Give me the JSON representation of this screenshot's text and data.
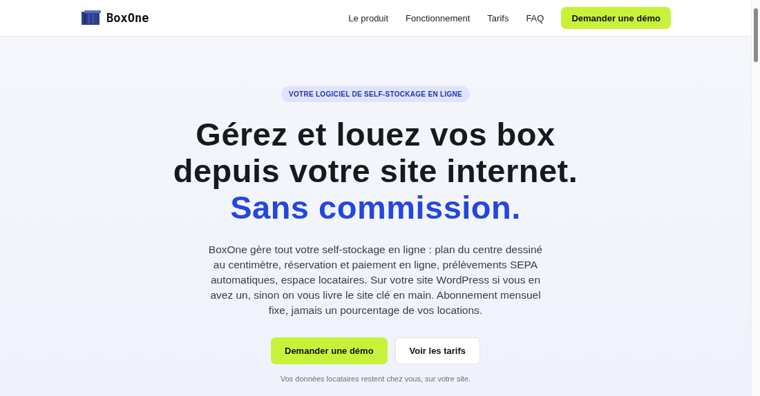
{
  "header": {
    "brand": "BoxOne",
    "nav": [
      "Le produit",
      "Fonctionnement",
      "Tarifs",
      "FAQ"
    ],
    "cta": "Demander une démo"
  },
  "hero": {
    "badge": "VOTRE LOGICIEL DE SELF-STOCKAGE EN LIGNE",
    "title_lines": [
      "Gérez et louez vos box",
      "depuis votre site internet."
    ],
    "title_accent": "Sans commission.",
    "description": "BoxOne gère tout votre self-stockage en ligne : plan du centre dessiné au centimètre, réservation et paiement en ligne, prélèvements SEPA automatiques, espace locataires. Sur votre site WordPress si vous en avez un, sinon on vous livre le site clé en main. Abonnement mensuel fixe, jamais un pourcentage de vos locations.",
    "buttons": [
      {
        "label": "Demander une démo",
        "kind": "primary"
      },
      {
        "label": "Voir les tarifs",
        "kind": "secondary"
      }
    ],
    "note": "Vos données locataires restent chez vous, sur votre site."
  }
}
